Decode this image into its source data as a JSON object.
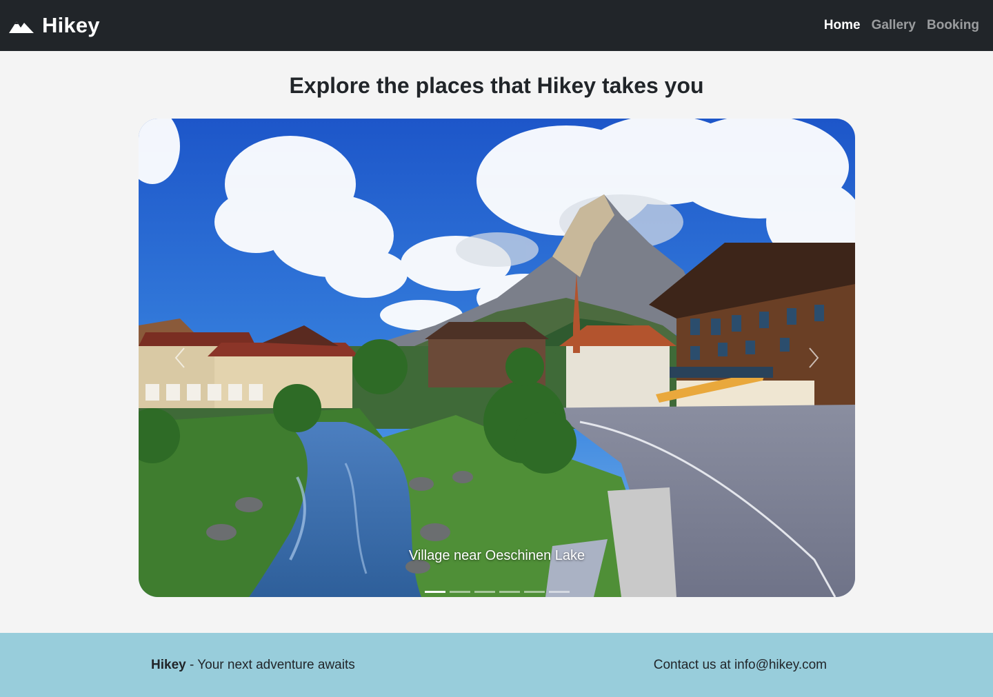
{
  "brand": {
    "name": "Hikey",
    "icon": "mountain-icon"
  },
  "nav": {
    "items": [
      {
        "label": "Home",
        "active": true
      },
      {
        "label": "Gallery",
        "active": false
      },
      {
        "label": "Booking",
        "active": false
      }
    ]
  },
  "main": {
    "title": "Explore the places that Hikey takes you"
  },
  "carousel": {
    "caption": "Village near Oeschinen Lake",
    "prev_icon": "chevron-left-icon",
    "next_icon": "chevron-right-icon",
    "slide_count": 6,
    "active_index": 0
  },
  "footer": {
    "brand": "Hikey",
    "tagline": " - Your next adventure awaits",
    "contact": "Contact us at info@hikey.com"
  },
  "colors": {
    "navbar": "#212529",
    "footer": "#98cddb",
    "background": "#f4f4f4"
  }
}
